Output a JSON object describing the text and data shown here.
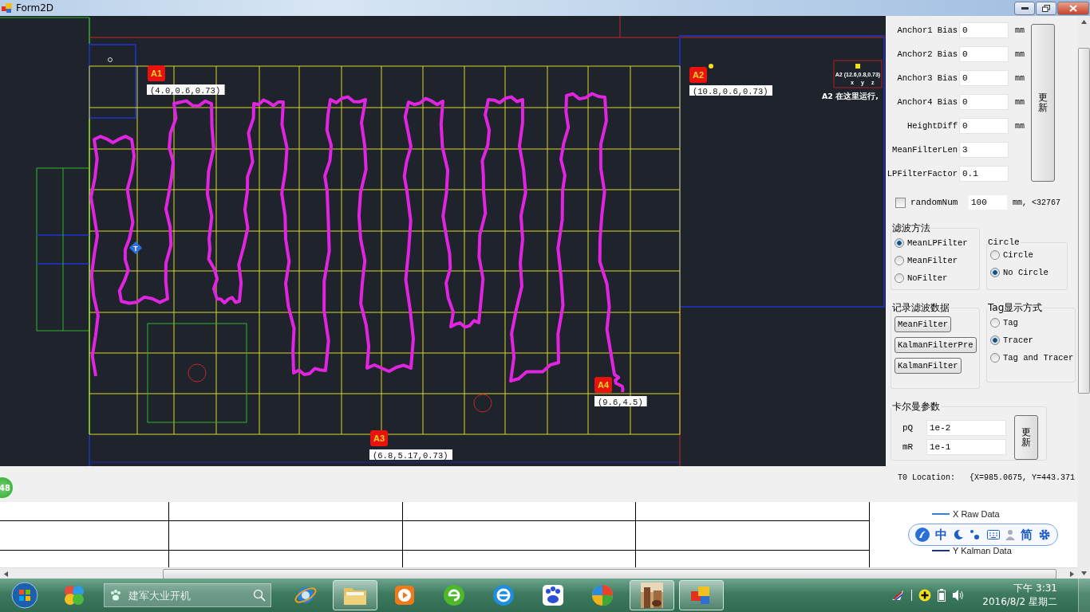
{
  "window": {
    "title": "Form2D"
  },
  "map": {
    "anchors": [
      {
        "badge": "A1",
        "coords": "(4.0,0.6,0.73)"
      },
      {
        "badge": "A2",
        "coords": "(10.8,0.6,0.73)"
      },
      {
        "badge": "A3",
        "coords": "(6.8,5.17,0.73)"
      },
      {
        "badge": "A4",
        "coords": "(9.6,4.5)"
      }
    ],
    "tag": {
      "label": "T"
    },
    "anchor_note": {
      "text": "A2 (12.6,0.8,0.73)",
      "axes": [
        "x",
        "y",
        "z"
      ],
      "caption": "A2 在这里运行,"
    }
  },
  "settings": {
    "fields": [
      {
        "label": "Anchor1 Bias",
        "value": "0",
        "unit": "mm"
      },
      {
        "label": "Anchor2 Bias",
        "value": "0",
        "unit": "mm"
      },
      {
        "label": "Anchor3 Bias",
        "value": "0",
        "unit": "mm"
      },
      {
        "label": "Anchor4 Bias",
        "value": "0",
        "unit": "mm"
      },
      {
        "label": "HeightDiff",
        "value": "0",
        "unit": "mm"
      },
      {
        "label": "MeanFilterLen",
        "value": "3"
      },
      {
        "label": "LPFilterFactor",
        "value": "0.1"
      }
    ],
    "update_button": "更新",
    "random": {
      "label": "randomNum",
      "checked": false,
      "value": "100",
      "note": "mm, <32767"
    },
    "filter_group": {
      "title": "滤波方法",
      "options": [
        {
          "label": "MeanLPFilter",
          "selected": true
        },
        {
          "label": "MeanFilter",
          "selected": false
        },
        {
          "label": "NoFilter",
          "selected": false
        }
      ]
    },
    "circle_group": {
      "title": "Circle",
      "options": [
        {
          "label": "Circle",
          "selected": false
        },
        {
          "label": "No Circle",
          "selected": true
        }
      ]
    },
    "record_group": {
      "title": "记录滤波数据",
      "buttons": [
        "MeanFilter",
        "KalmanFilterPre",
        "KalmanFilter"
      ]
    },
    "tag_group": {
      "title": "Tag显示方式",
      "options": [
        {
          "label": "Tag",
          "selected": false
        },
        {
          "label": "Tracer",
          "selected": true
        },
        {
          "label": "Tag and Tracer",
          "selected": false
        }
      ]
    },
    "kalman": {
      "title": "卡尔曼参数",
      "fields": [
        {
          "label": "pQ",
          "value": "1e-2"
        },
        {
          "label": "mR",
          "value": "1e-1"
        }
      ],
      "button": "更新"
    },
    "location": {
      "label": "T0 Location:",
      "value": "{X=985.0675, Y=443.371"
    }
  },
  "status_badge": "48",
  "legend": [
    "X Raw Data",
    "Y Kalman Data"
  ],
  "ime_bar": {
    "language": "中",
    "script": "简"
  },
  "taskbar": {
    "search_placeholder": "建军大业开机",
    "clock": {
      "time": "下午 3:31",
      "date": "2016/8/2 星期二"
    }
  }
}
